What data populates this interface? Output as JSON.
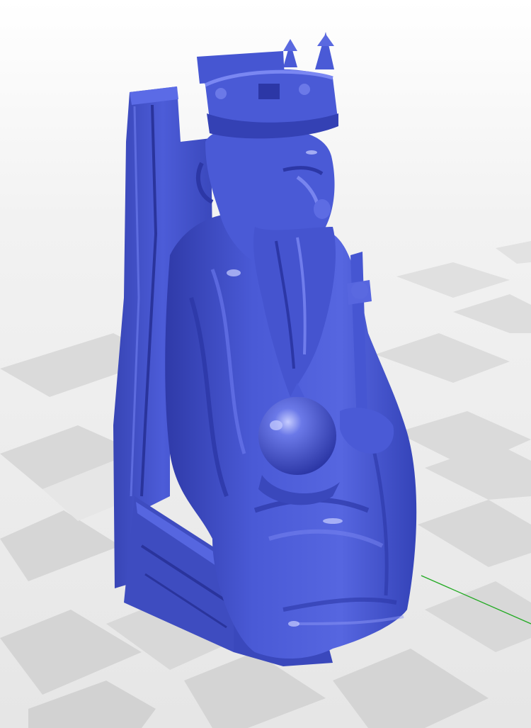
{
  "viewer": {
    "background_color": "#f0f0f0",
    "floor_light_color": "#f4f4f4",
    "floor_dark_color": "#d6d6d6",
    "model_color": "#4a5ad6",
    "model_shadow_color": "#2c37a6",
    "model_highlight_color": "#9aa6ff",
    "axis_y_color": "#22aa22"
  },
  "model": {
    "subject": "seated-king-chess-piece",
    "parts": [
      "throne",
      "crown",
      "head",
      "beard",
      "robe",
      "orb",
      "scepter",
      "base"
    ]
  },
  "icons": {
    "axis": "axis-line-icon"
  }
}
